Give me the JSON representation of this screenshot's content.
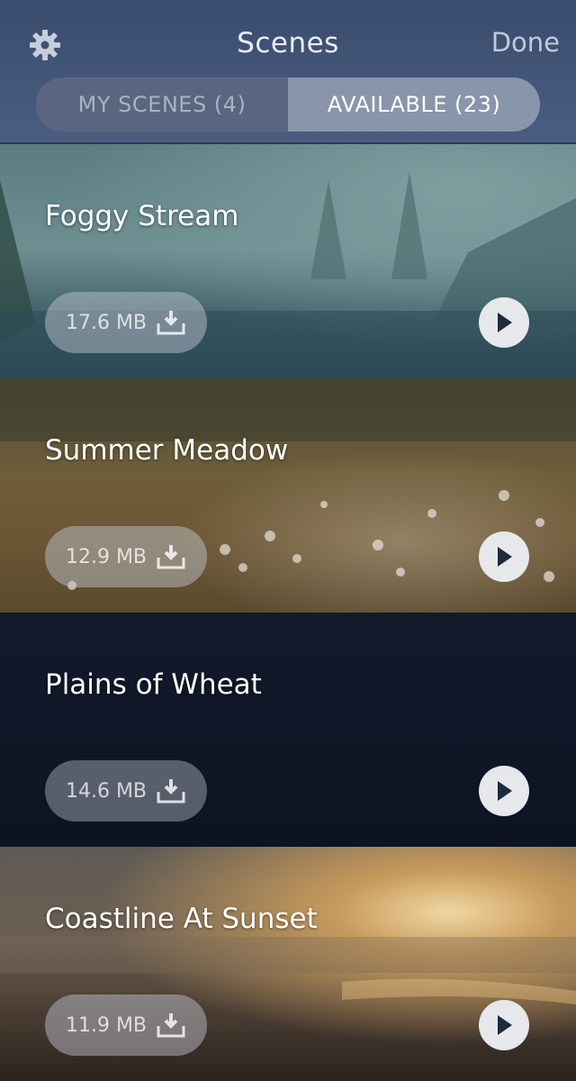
{
  "header": {
    "title": "Scenes",
    "done_label": "Done",
    "settings_icon": "gear-icon"
  },
  "segments": {
    "left_label": "MY SCENES (4)",
    "right_label": "AVAILABLE (23)",
    "selected": "AVAILABLE (23)"
  },
  "scenes": [
    {
      "name": "Foggy Stream",
      "size": "17.6 MB",
      "download_icon": "download-icon",
      "play_icon": "play-icon"
    },
    {
      "name": "Summer Meadow",
      "size": "12.9 MB",
      "download_icon": "download-icon",
      "play_icon": "play-icon"
    },
    {
      "name": "Plains of Wheat",
      "size": "14.6 MB",
      "download_icon": "download-icon",
      "play_icon": "play-icon"
    },
    {
      "name": "Coastline At Sunset",
      "size": "11.9 MB",
      "download_icon": "download-icon",
      "play_icon": "play-icon"
    }
  ],
  "colors": {
    "header_bg": "#3a4c6d",
    "segment_selected": "#8995aa",
    "segment_unselected": "#5a6680"
  }
}
